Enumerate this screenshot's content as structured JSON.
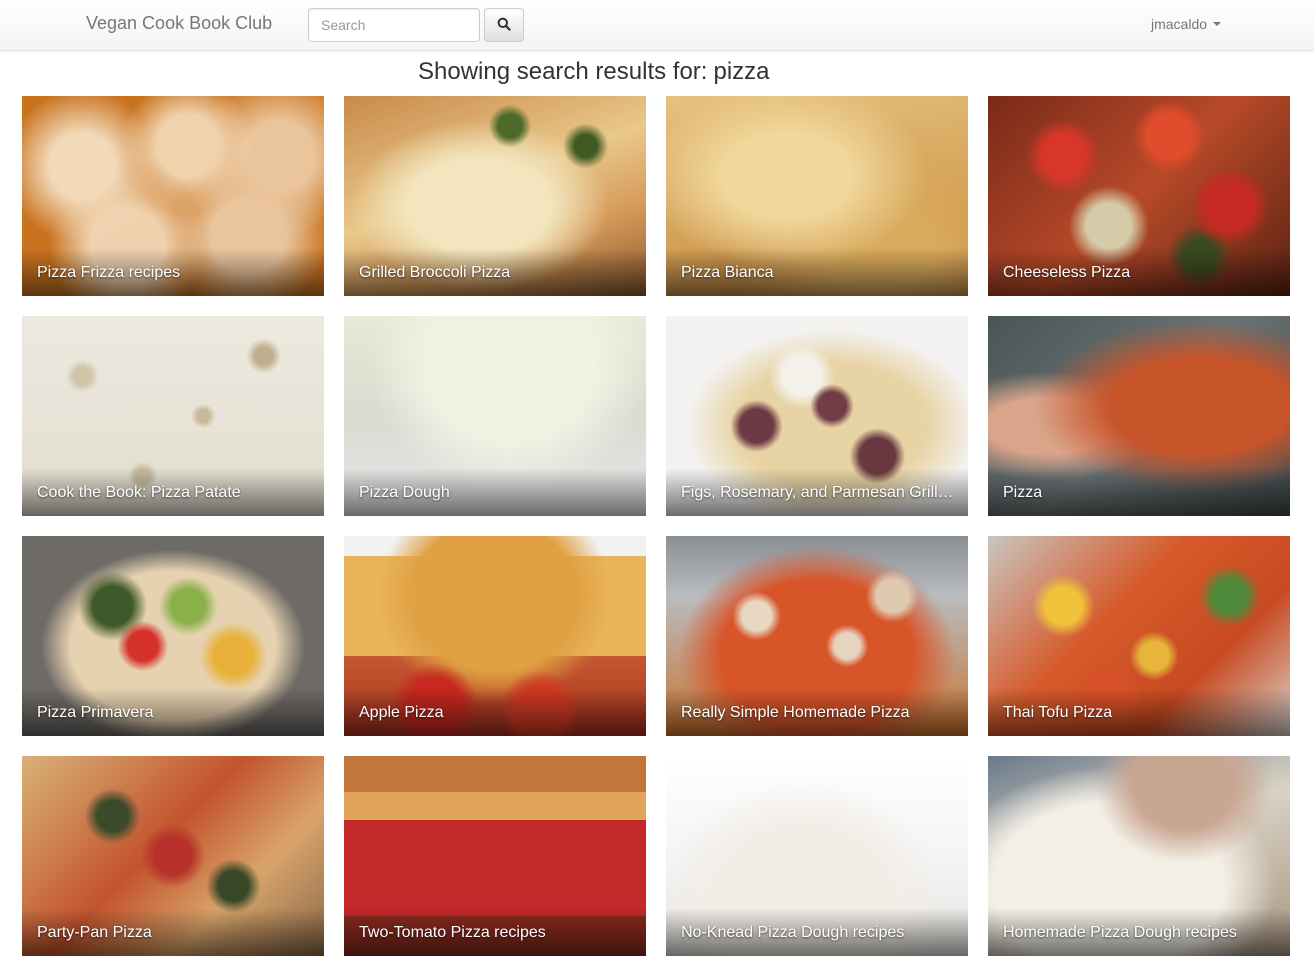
{
  "navbar": {
    "brand": "Vegan Cook Book Club",
    "search_placeholder": "Search",
    "search_value": "",
    "user": "jmacaldo"
  },
  "results": {
    "prefix": "Showing search results for:",
    "query": "pizza"
  },
  "recipes": [
    {
      "title": "Pizza Frizza recipes"
    },
    {
      "title": "Grilled Broccoli Pizza"
    },
    {
      "title": "Pizza Bianca"
    },
    {
      "title": "Cheeseless Pizza"
    },
    {
      "title": "Cook the Book: Pizza Patate"
    },
    {
      "title": "Pizza Dough"
    },
    {
      "title": "Figs, Rosemary, and Parmesan Grilled…"
    },
    {
      "title": "Pizza"
    },
    {
      "title": "Pizza Primavera"
    },
    {
      "title": "Apple Pizza"
    },
    {
      "title": "Really Simple Homemade Pizza"
    },
    {
      "title": "Thai Tofu Pizza"
    },
    {
      "title": "Party-Pan Pizza"
    },
    {
      "title": "Two-Tomato Pizza recipes"
    },
    {
      "title": "No-Knead Pizza Dough recipes"
    },
    {
      "title": "Homemade Pizza Dough recipes"
    }
  ]
}
